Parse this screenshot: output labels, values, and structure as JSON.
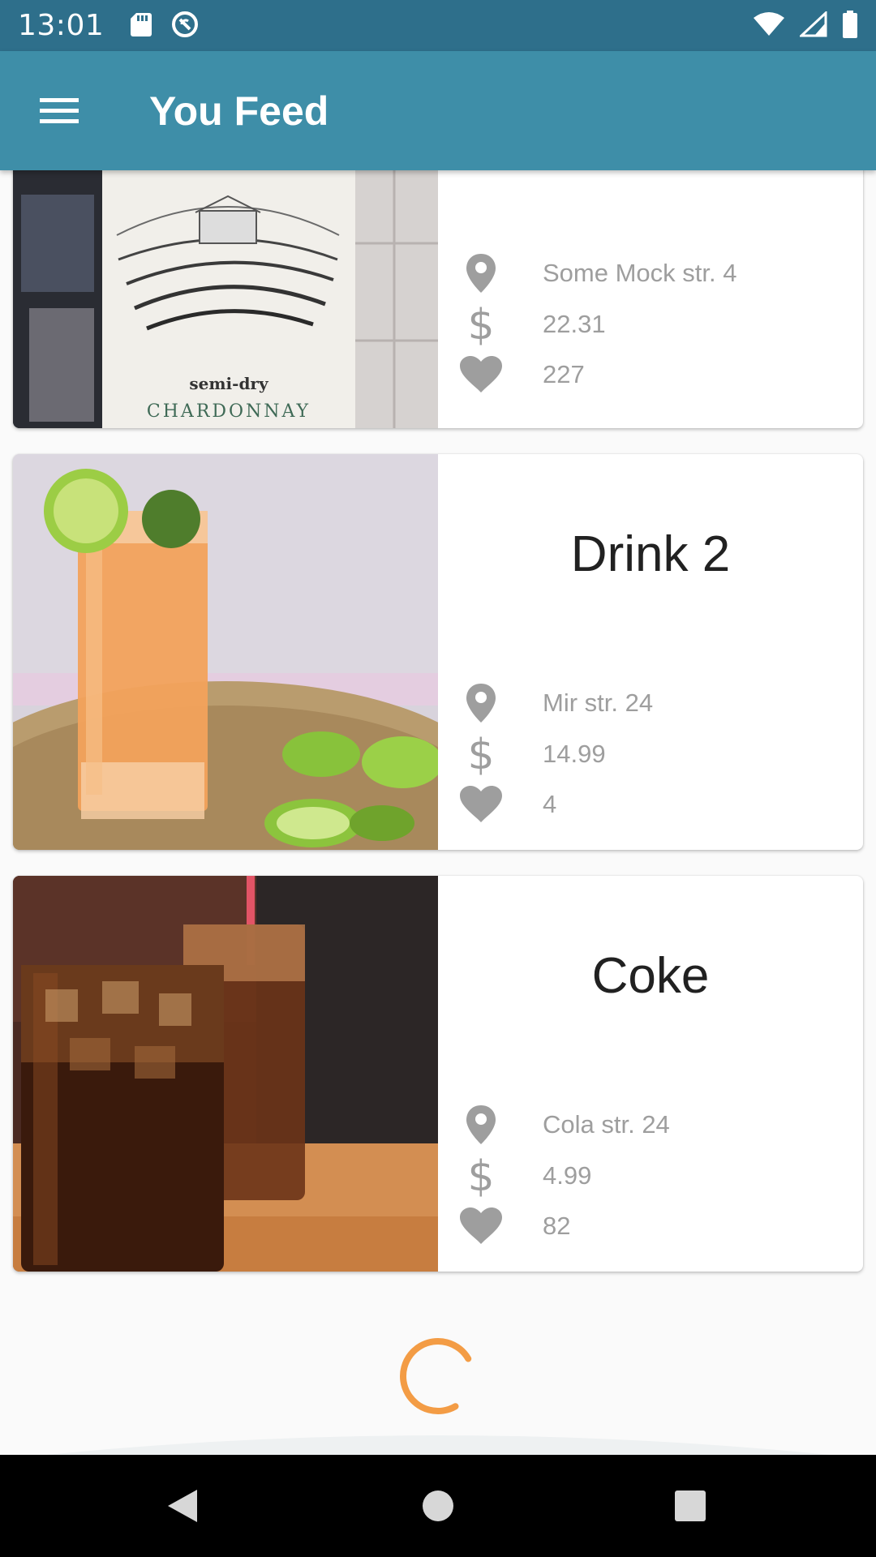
{
  "status_bar": {
    "time": "13:01",
    "left_icons": [
      "sd-card-icon",
      "no-data-icon"
    ],
    "right_icons": [
      "wifi-icon",
      "signal-icon",
      "battery-icon"
    ]
  },
  "app_bar": {
    "title": "You Feed",
    "menu_icon": "hamburger-menu-icon"
  },
  "feed": {
    "items": [
      {
        "title": "",
        "image": "white wine bottle with 'semi-dry CHARDONNAY' label",
        "image_label_line1": "semi-dry",
        "image_label_line2": "CHARDONNAY",
        "address": "Some Mock str. 4",
        "price": "22.31",
        "likes": "227"
      },
      {
        "title": "Drink 2",
        "image": "orange cocktail with lime slices",
        "address": "Mir str. 24",
        "price": "14.99",
        "likes": "4"
      },
      {
        "title": "Coke",
        "image": "glasses of cola with ice",
        "address": "Cola str. 24",
        "price": "4.99",
        "likes": "82"
      }
    ]
  },
  "colors": {
    "status_bar": "#2e6f8b",
    "app_bar": "#3e8ea8",
    "spinner": "#f39c45",
    "icon_gray": "#9e9e9e"
  },
  "nav_bar": {
    "icons": [
      "back-icon",
      "home-icon",
      "recents-icon"
    ]
  }
}
